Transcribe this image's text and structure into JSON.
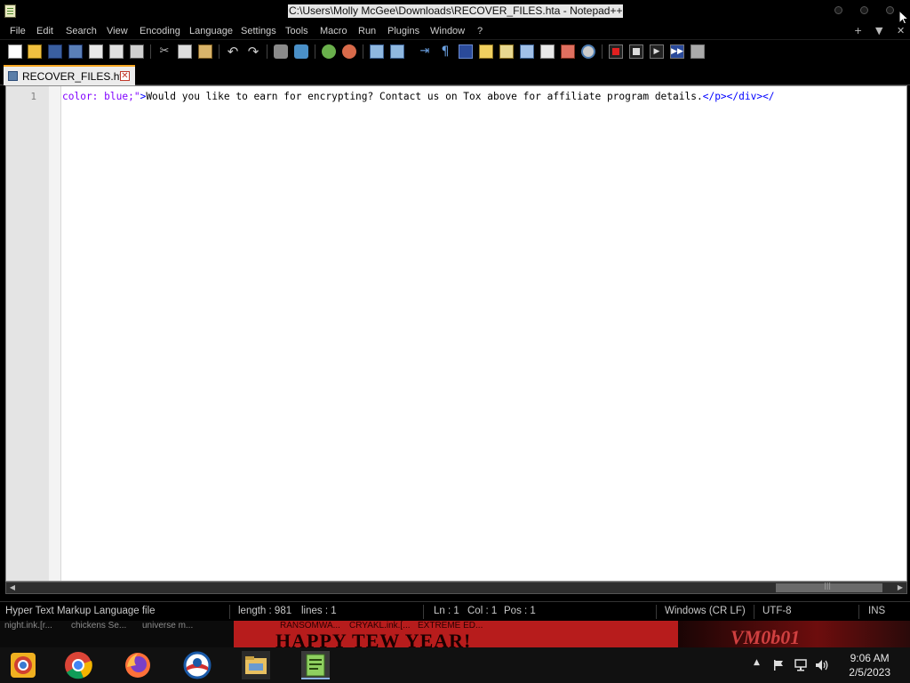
{
  "window": {
    "title": "C:\\Users\\Molly McGee\\Downloads\\RECOVER_FILES.hta - Notepad++"
  },
  "menu": {
    "items": [
      "File",
      "Edit",
      "Search",
      "View",
      "Encoding",
      "Language",
      "Settings",
      "Tools",
      "Macro",
      "Run",
      "Plugins",
      "Window",
      "?"
    ],
    "right": {
      "add": "+",
      "dropdown": "▼",
      "close": "✕"
    }
  },
  "toolbar": {
    "buttons": [
      "new-file",
      "open-file",
      "save",
      "save-all",
      "close",
      "close-all",
      "print",
      "cut",
      "copy",
      "paste",
      "undo",
      "redo",
      "find",
      "replace",
      "zoom-in",
      "zoom-out",
      "sync-vertical",
      "sync-horizontal",
      "word-wrap",
      "show-all-characters",
      "indent-guide",
      "user-defined-language",
      "document-map",
      "document-list",
      "function-list",
      "folder-as-workspace",
      "monitoring",
      "record-macro",
      "stop-recording",
      "playback-macro",
      "run-macro-multiple",
      "save-macro"
    ]
  },
  "tab": {
    "label": "RECOVER_FILES.hta",
    "close": "✕"
  },
  "editor": {
    "line_number": "1",
    "code": {
      "attr_part": "color: blue;\"",
      "tag_open": ">",
      "text_part": "Would you like to earn for encrypting? Contact us on Tox above for affiliate program details.",
      "tag_close": "</p></div></"
    }
  },
  "scrollbar": {
    "left_arrow": "◀",
    "right_arrow": "▶",
    "grip": "|||"
  },
  "status": {
    "file_type": "Hyper Text Markup Language file",
    "length": "length : 981",
    "lines": "lines : 1",
    "ln": "Ln : 1",
    "col": "Col : 1",
    "pos": "Pos : 1",
    "eol": "Windows (CR LF)",
    "encoding": "UTF-8",
    "mode": "INS"
  },
  "desktop": {
    "thumbs": [
      "night.ink.[r...",
      "chickens Se...",
      "universe m...",
      "RANSOMWA...",
      "CRYAKL.ink.[...",
      "EXTREME ED..."
    ],
    "headline": "HAPPY TEW YEAR!",
    "tag": "VM0b01"
  },
  "taskbar": {
    "apps": [
      "chrome-canary",
      "chrome",
      "firefox",
      "outlook",
      "file-explorer",
      "notepad-plus-plus"
    ],
    "time": "9:06 AM",
    "date": "2/5/2023"
  },
  "colors": {
    "attr": "#8000ff",
    "tag": "#0000ff",
    "tab_accent": "#f5a623",
    "wallpaper": "#b71c1c"
  }
}
